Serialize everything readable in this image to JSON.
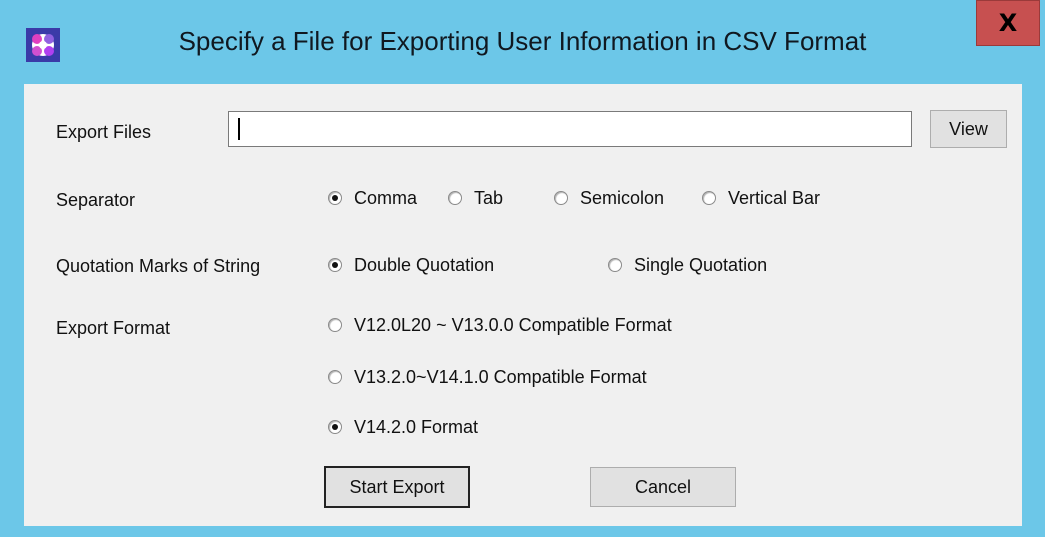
{
  "window": {
    "title": "Specify a File for Exporting User Information in CSV Format",
    "close_label": "X",
    "app_icon": "app-flower-icon"
  },
  "export_files": {
    "label": "Export Files",
    "value": "",
    "view_button": "View"
  },
  "separator": {
    "label": "Separator",
    "options": [
      {
        "label": "Comma",
        "selected": true
      },
      {
        "label": "Tab",
        "selected": false
      },
      {
        "label": "Semicolon",
        "selected": false
      },
      {
        "label": "Vertical Bar",
        "selected": false
      }
    ]
  },
  "quotation": {
    "label": "Quotation Marks of String",
    "options": [
      {
        "label": "Double Quotation",
        "selected": true
      },
      {
        "label": "Single Quotation",
        "selected": false
      }
    ]
  },
  "export_format": {
    "label": "Export Format",
    "options": [
      {
        "label": "V12.0L20 ~ V13.0.0 Compatible Format",
        "selected": false
      },
      {
        "label": "V13.2.0~V14.1.0 Compatible Format",
        "selected": false
      },
      {
        "label": "V14.2.0 Format",
        "selected": true
      }
    ]
  },
  "actions": {
    "start_export": "Start Export",
    "cancel": "Cancel"
  },
  "colors": {
    "title_bar": "#6cc7e8",
    "close_button": "#c75050",
    "client_bg": "#f0f0f0"
  }
}
